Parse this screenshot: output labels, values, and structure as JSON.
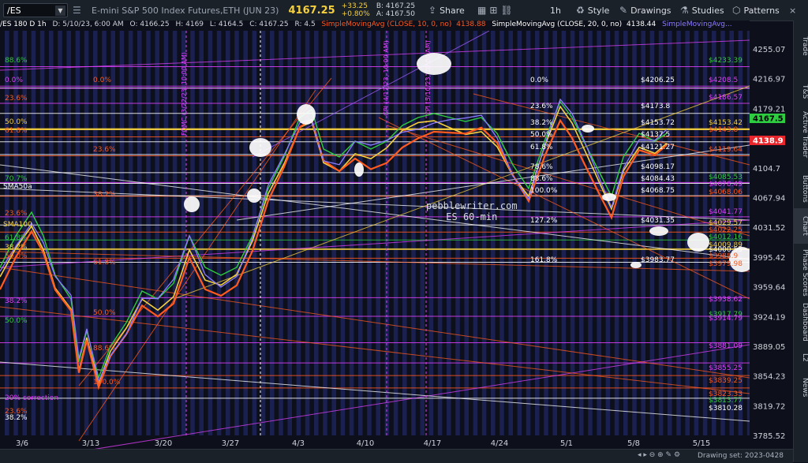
{
  "toolbar": {
    "symbol": "/ES",
    "description": "E-mini S&P 500 Index Futures,ETH (JUN 23)",
    "last": "4167.25",
    "change": "+33.25",
    "change_pct": "+0.80%",
    "bid": "B: 4167.25",
    "ask": "A: 4167.50",
    "share": "Share",
    "interval": "1h",
    "style": "Style",
    "drawings": "Drawings",
    "studies": "Studies",
    "patterns": "Patterns"
  },
  "infobar": {
    "series": "/ES 180 D 1h",
    "date": "D: 5/10/23, 6:00 AM",
    "open": "O: 4166.25",
    "high": "H: 4169",
    "low": "L: 4164.5",
    "close": "C: 4167.25",
    "range": "R: 4.5",
    "sma10": "SimpleMovingAvg (CLOSE, 10, 0, no)",
    "sma10_val": "4138.88",
    "sma20": "SimpleMovingAvg (CLOSE, 20, 0, no)",
    "sma20_val": "4138.44",
    "sma_more": "SimpleMovingAvg..."
  },
  "chart": {
    "watermark_line1": "pebblewriter.com",
    "watermark_line2": "ES 60-min",
    "x_labels": [
      "3/6",
      "3/13",
      "3/20",
      "3/27",
      "4/3",
      "4/10",
      "4/17",
      "4/24",
      "5/1",
      "5/8",
      "5/15"
    ],
    "price_axis": [
      "4255.07",
      "4216.97",
      "4179.21",
      "4141.52",
      "4104.7",
      "4067.94",
      "4031.52",
      "3995.42",
      "3959.64",
      "3924.19",
      "3889.05",
      "3854.23",
      "3819.72",
      "3785.52"
    ],
    "last_price_tag": "4167.5",
    "sma_tag": "4138.9",
    "vlabels": [
      "FOMC (3/22/23, 10:00 AM)",
      "CPI (4/12/23, 10:00 AM)",
      "CPI (5/10/23, 10:00 AM)"
    ],
    "fib_right": [
      {
        "pct": "0.0%",
        "price": "$4206.25"
      },
      {
        "pct": "23.6%",
        "price": "$4173.8"
      },
      {
        "pct": "38.2%",
        "price": "$4153.72"
      },
      {
        "pct": "50.0%",
        "price": "$4137.5"
      },
      {
        "pct": "61.8%",
        "price": "$4121.27"
      },
      {
        "pct": "78.6%",
        "price": "$4098.17"
      },
      {
        "pct": "88.6%",
        "price": "$4084.43"
      },
      {
        "pct": "100.0%",
        "price": "$4068.75"
      },
      {
        "pct": "127.2%",
        "price": "$4031.35"
      },
      {
        "pct": "161.8%",
        "price": "$3983.77"
      }
    ],
    "right_levels": [
      "$4233.39",
      "$4208.5",
      "$4186.57",
      "$4153.42",
      "$4143.8",
      "$4119.64",
      "$4085.53",
      "$4078.49",
      "$4068.06",
      "$4041.77",
      "$4029.57",
      "$4022.25",
      "$4012.16",
      "$4009.89",
      "$4000.55",
      "$3988.9",
      "$3979.98",
      "$3938.62",
      "$3917.79",
      "$3914.79",
      "$3881.09",
      "$3855.25",
      "$3839.25",
      "$3823.33",
      "$3813.77",
      "$3810.28"
    ],
    "left_labels": [
      "88.6%",
      "0.0%",
      "23.6%",
      "50.0%",
      "61.8%",
      "23.6%",
      "38.2%",
      "70.7%",
      "SMA50a",
      "23.6%",
      "SMA100",
      "61.8%",
      "38.2%",
      "50.0%",
      "38.2%",
      "50.0%",
      "50.0%",
      "100.0%",
      "20% correction",
      "23.6%",
      "38.2%",
      "0.0%",
      "61.8%",
      "88.6%"
    ]
  },
  "sidebar": [
    "Trade",
    "T&S",
    "Active Trader",
    "Buttons",
    "Chart",
    "Phase Scores",
    "Dashboard",
    "L2",
    "News"
  ],
  "bottombar": {
    "drawing_set": "Drawing set: 2023-0428"
  },
  "colors": {
    "accent": "#f4d03f",
    "magenta": "#e040fb",
    "orange": "#ff5a1f",
    "green": "#2ecc40"
  }
}
